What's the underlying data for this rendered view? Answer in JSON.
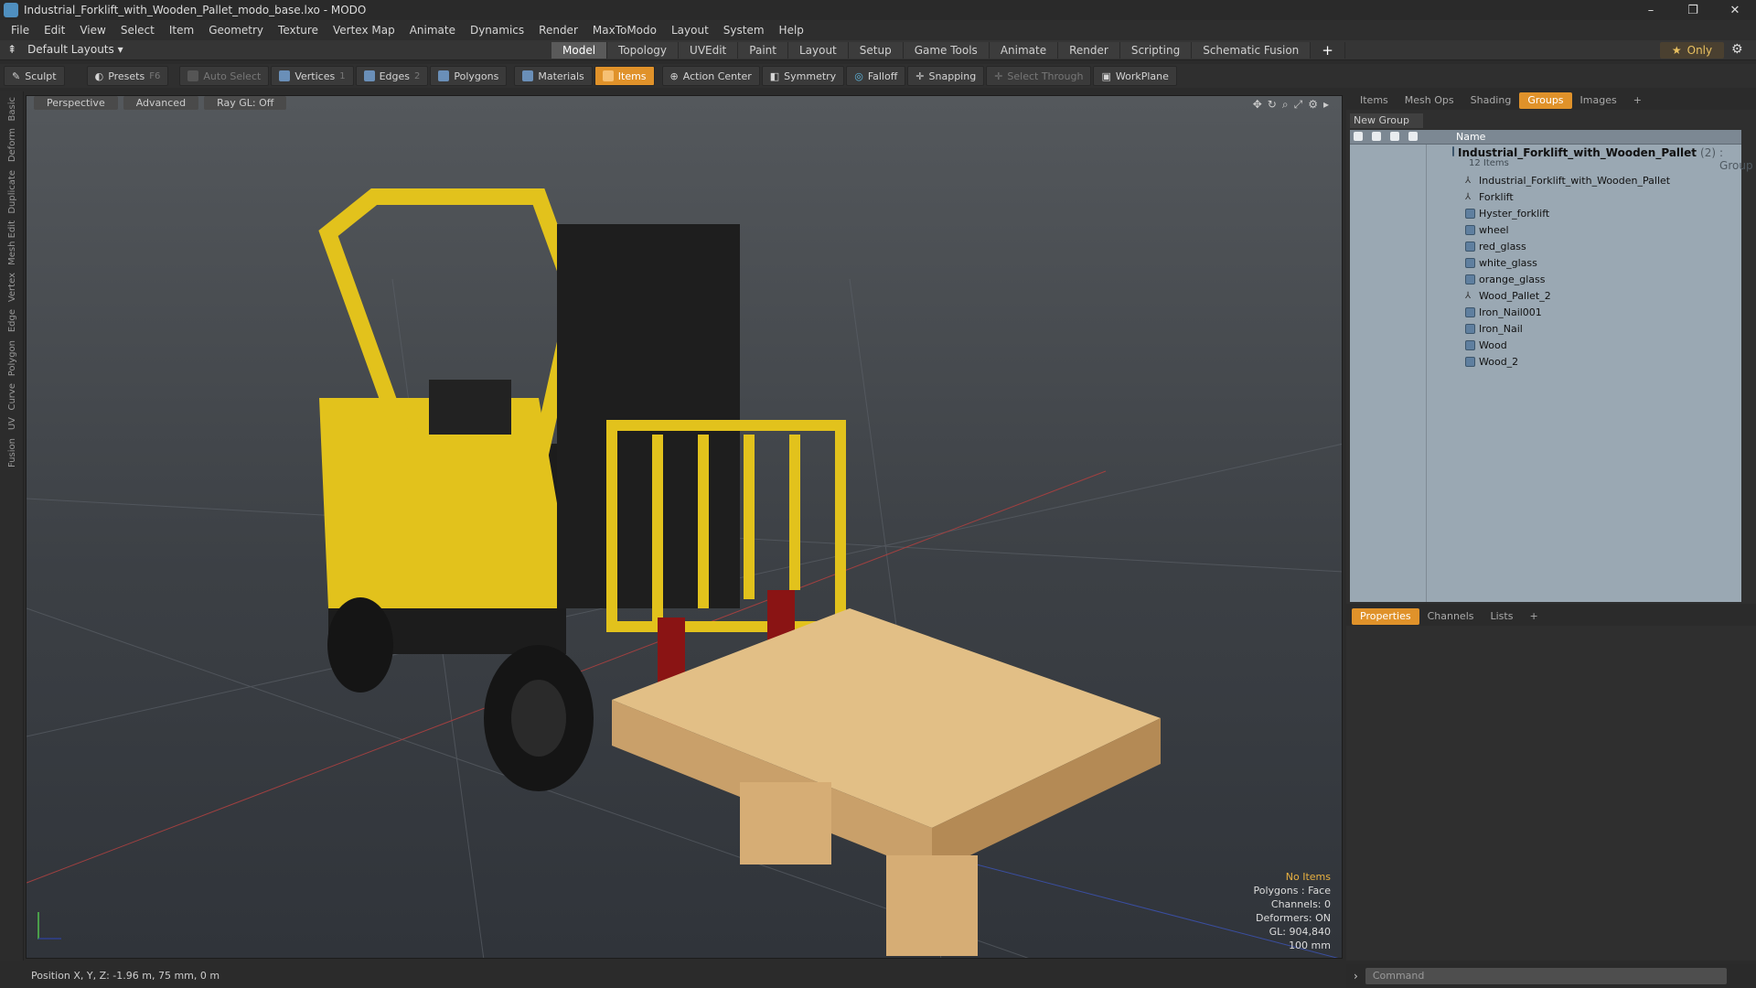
{
  "window": {
    "title": "Industrial_Forklift_with_Wooden_Pallet_modo_base.lxo - MODO",
    "controls": [
      "–",
      "❐",
      "✕"
    ]
  },
  "menu": [
    "File",
    "Edit",
    "View",
    "Select",
    "Item",
    "Geometry",
    "Texture",
    "Vertex Map",
    "Animate",
    "Dynamics",
    "Render",
    "MaxToModo",
    "Layout",
    "System",
    "Help"
  ],
  "layout": {
    "name": "Default Layouts ▾",
    "tabs": [
      "Model",
      "Topology",
      "UVEdit",
      "Paint",
      "Layout",
      "Setup",
      "Game Tools",
      "Animate",
      "Render",
      "Scripting",
      "Schematic Fusion",
      "+"
    ],
    "active": "Model",
    "only_label": "Only"
  },
  "toolbar": {
    "sculpt": "Sculpt",
    "presets": "Presets",
    "presets_key": "F6",
    "auto_select": "Auto Select",
    "vertices": "Vertices",
    "vertices_count": "1",
    "edges": "Edges",
    "edges_count": "2",
    "polygons": "Polygons",
    "materials": "Materials",
    "items": "Items",
    "action_center": "Action Center",
    "symmetry": "Symmetry",
    "falloff": "Falloff",
    "snapping": "Snapping",
    "select_through": "Select Through",
    "workplane": "WorkPlane"
  },
  "left_tabs": [
    "Basic",
    "Deform",
    "Duplicate",
    "Mesh Edit",
    "Vertex",
    "Edge",
    "Polygon",
    "Curve",
    "UV",
    "Fusion"
  ],
  "viewport": {
    "view": "Perspective",
    "mode": "Advanced",
    "raygl": "Ray GL: Off",
    "stats": {
      "selection": "No Items",
      "polygons": "Polygons : Face",
      "channels": "Channels: 0",
      "deformers": "Deformers: ON",
      "gl": "GL: 904,840",
      "scale": "100 mm"
    }
  },
  "right_panel": {
    "tabs": [
      "Items",
      "Mesh Ops",
      "Shading",
      "Groups",
      "Images",
      "+"
    ],
    "active": "Groups",
    "new_group": "New Group",
    "col_name": "Name",
    "group": {
      "name": "Industrial_Forklift_with_Wooden_Pallet",
      "count": "(2)",
      "tag": ": Group",
      "items_label": "12 Items"
    },
    "items": [
      "Industrial_Forklift_with_Wooden_Pallet",
      "Forklift",
      "Hyster_forklift",
      "wheel",
      "red_glass",
      "white_glass",
      "orange_glass",
      "Wood_Pallet_2",
      "Iron_Nail001",
      "Iron_Nail",
      "Wood",
      "Wood_2"
    ]
  },
  "props": {
    "tabs": [
      "Properties",
      "Channels",
      "Lists",
      "+"
    ],
    "active": "Properties"
  },
  "status": {
    "position": "Position X, Y, Z:  -1.96 m, 75 mm, 0 m"
  },
  "command": {
    "placeholder": "Command"
  }
}
